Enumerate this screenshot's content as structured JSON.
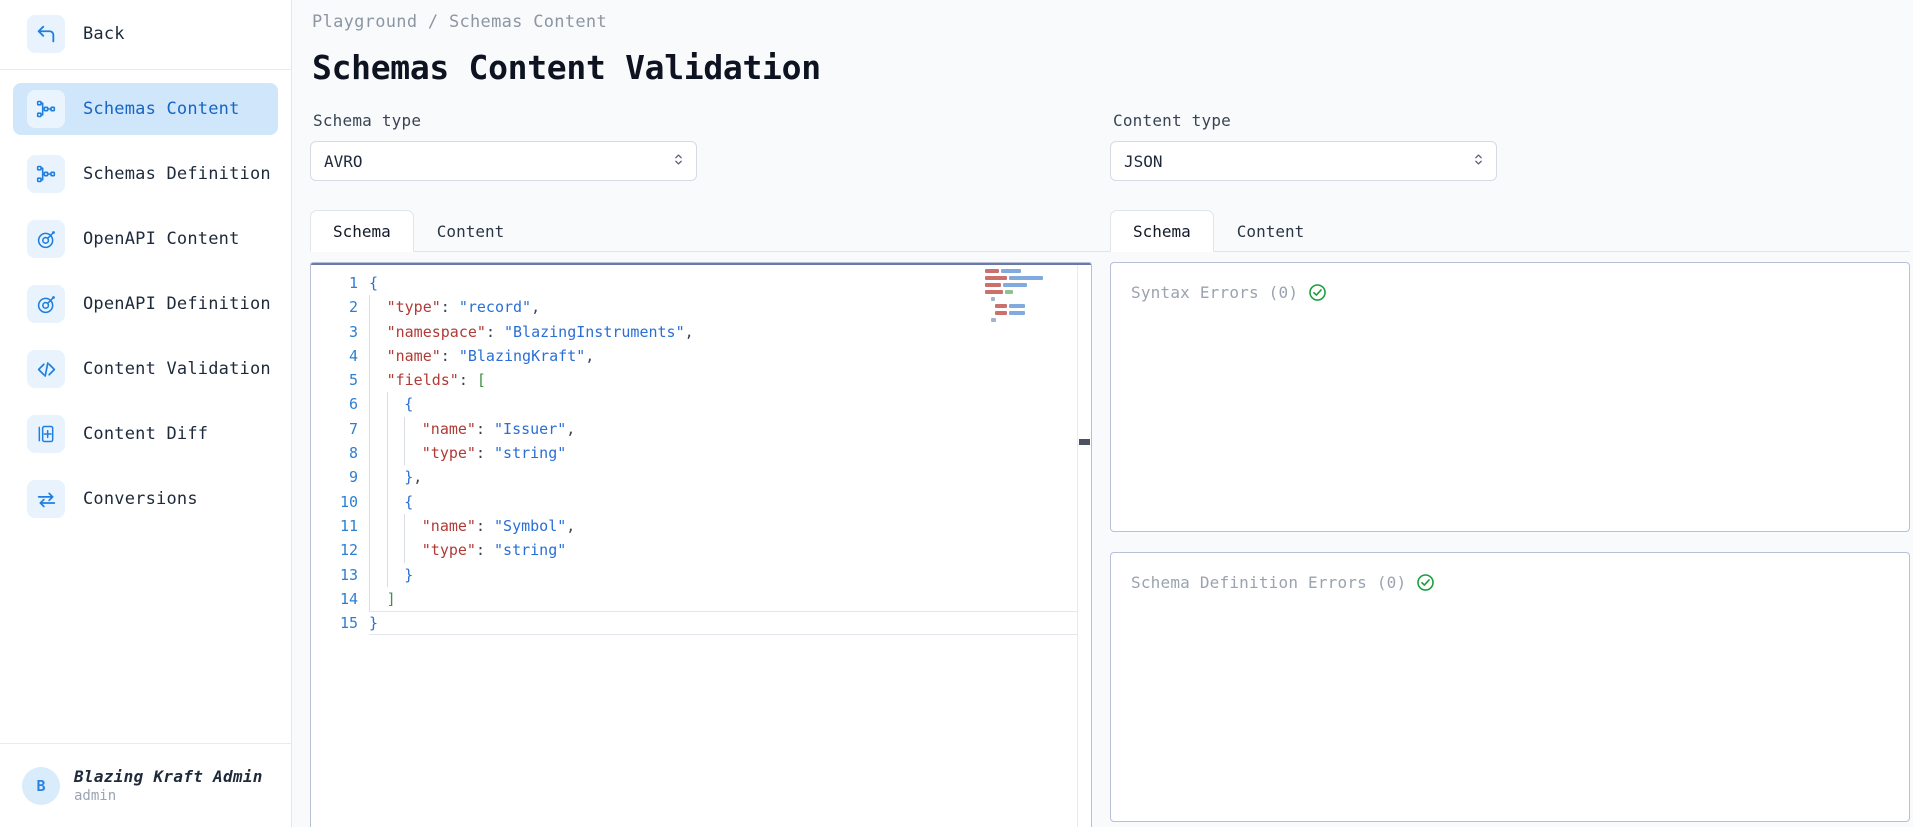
{
  "sidebar": {
    "back": {
      "label": "Back",
      "icon": "back-arrow-icon"
    },
    "items": [
      {
        "label": "Schemas Content",
        "icon": "schema-node-icon",
        "active": true
      },
      {
        "label": "Schemas Definition",
        "icon": "schema-node-icon",
        "active": false
      },
      {
        "label": "OpenAPI Content",
        "icon": "openapi-icon",
        "active": false
      },
      {
        "label": "OpenAPI Definition",
        "icon": "openapi-icon",
        "active": false
      },
      {
        "label": "Content Validation",
        "icon": "code-brackets-icon",
        "active": false
      },
      {
        "label": "Content Diff",
        "icon": "document-diff-icon",
        "active": false
      },
      {
        "label": "Conversions",
        "icon": "exchange-arrows-icon",
        "active": false
      }
    ],
    "user": {
      "initial": "B",
      "name": "Blazing Kraft Admin",
      "role": "admin"
    }
  },
  "header": {
    "breadcrumb": "Playground / Schemas Content",
    "title": "Schemas Content Validation"
  },
  "left_panel": {
    "select_label": "Schema type",
    "select_value": "AVRO",
    "tabs": [
      {
        "label": "Schema",
        "active": true
      },
      {
        "label": "Content",
        "active": false
      }
    ],
    "editor": {
      "language": "json",
      "total_lines": 15,
      "current_line": 15,
      "lines": [
        {
          "n": 1,
          "indent": 0,
          "tokens": [
            {
              "t": "{",
              "c": "brace"
            }
          ]
        },
        {
          "n": 2,
          "indent": 1,
          "tokens": [
            {
              "t": "\"type\"",
              "c": "key"
            },
            {
              "t": ": ",
              "c": "punc"
            },
            {
              "t": "\"record\"",
              "c": "str"
            },
            {
              "t": ",",
              "c": "punc"
            }
          ]
        },
        {
          "n": 3,
          "indent": 1,
          "tokens": [
            {
              "t": "\"namespace\"",
              "c": "key"
            },
            {
              "t": ": ",
              "c": "punc"
            },
            {
              "t": "\"BlazingInstruments\"",
              "c": "str"
            },
            {
              "t": ",",
              "c": "punc"
            }
          ]
        },
        {
          "n": 4,
          "indent": 1,
          "tokens": [
            {
              "t": "\"name\"",
              "c": "key"
            },
            {
              "t": ": ",
              "c": "punc"
            },
            {
              "t": "\"BlazingKraft\"",
              "c": "str"
            },
            {
              "t": ",",
              "c": "punc"
            }
          ]
        },
        {
          "n": 5,
          "indent": 1,
          "tokens": [
            {
              "t": "\"fields\"",
              "c": "key"
            },
            {
              "t": ": ",
              "c": "punc"
            },
            {
              "t": "[",
              "c": "bracket"
            }
          ]
        },
        {
          "n": 6,
          "indent": 2,
          "tokens": [
            {
              "t": "{",
              "c": "brace"
            }
          ]
        },
        {
          "n": 7,
          "indent": 3,
          "tokens": [
            {
              "t": "\"name\"",
              "c": "key"
            },
            {
              "t": ": ",
              "c": "punc"
            },
            {
              "t": "\"Issuer\"",
              "c": "str"
            },
            {
              "t": ",",
              "c": "punc"
            }
          ]
        },
        {
          "n": 8,
          "indent": 3,
          "tokens": [
            {
              "t": "\"type\"",
              "c": "key"
            },
            {
              "t": ": ",
              "c": "punc"
            },
            {
              "t": "\"string\"",
              "c": "str"
            }
          ]
        },
        {
          "n": 9,
          "indent": 2,
          "tokens": [
            {
              "t": "}",
              "c": "brace"
            },
            {
              "t": ",",
              "c": "punc"
            }
          ]
        },
        {
          "n": 10,
          "indent": 2,
          "tokens": [
            {
              "t": "{",
              "c": "brace"
            }
          ]
        },
        {
          "n": 11,
          "indent": 3,
          "tokens": [
            {
              "t": "\"name\"",
              "c": "key"
            },
            {
              "t": ": ",
              "c": "punc"
            },
            {
              "t": "\"Symbol\"",
              "c": "str"
            },
            {
              "t": ",",
              "c": "punc"
            }
          ]
        },
        {
          "n": 12,
          "indent": 3,
          "tokens": [
            {
              "t": "\"type\"",
              "c": "key"
            },
            {
              "t": ": ",
              "c": "punc"
            },
            {
              "t": "\"string\"",
              "c": "str"
            }
          ]
        },
        {
          "n": 13,
          "indent": 2,
          "tokens": [
            {
              "t": "}",
              "c": "brace"
            }
          ]
        },
        {
          "n": 14,
          "indent": 1,
          "tokens": [
            {
              "t": "]",
              "c": "bracket"
            }
          ]
        },
        {
          "n": 15,
          "indent": 0,
          "tokens": [
            {
              "t": "}",
              "c": "brace"
            }
          ]
        }
      ]
    }
  },
  "right_panel": {
    "select_label": "Content type",
    "select_value": "JSON",
    "tabs": [
      {
        "label": "Schema",
        "active": true
      },
      {
        "label": "Content",
        "active": false
      }
    ],
    "results": [
      {
        "label": "Syntax Errors (0)",
        "status": "ok",
        "icon": "check-circle-icon"
      },
      {
        "label": "Schema Definition Errors (0)",
        "status": "ok",
        "icon": "check-circle-icon"
      }
    ]
  },
  "colors": {
    "accent": "#1f7fe0",
    "active_nav_bg": "#cfe6fb",
    "success": "#1a9e3e",
    "page_bg": "#f8fafc",
    "border": "#b9c0d6"
  }
}
